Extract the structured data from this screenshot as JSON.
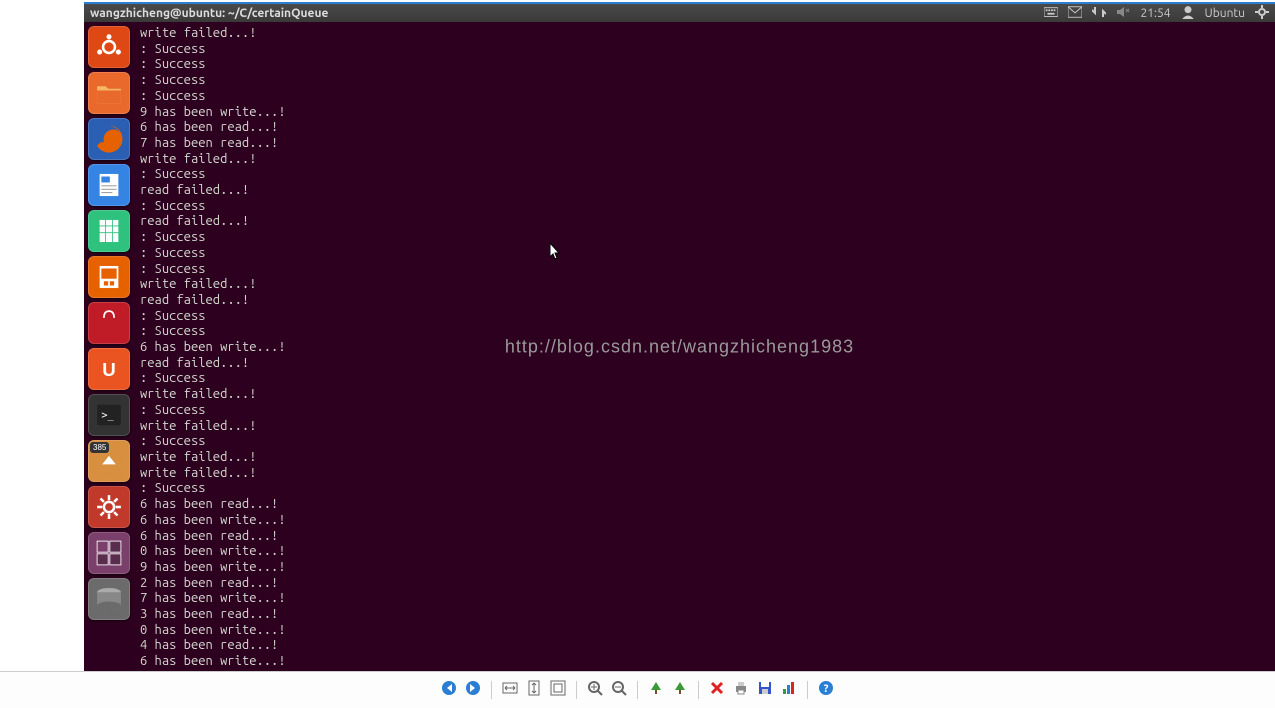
{
  "topbar": {
    "title": "wangzhicheng@ubuntu: ~/C/certainQueue",
    "time": "21:54",
    "user": "Ubuntu"
  },
  "watermark": "http://blog.csdn.net/wangzhicheng1983",
  "terminal_lines": [
    "write failed...!",
    ": Success",
    ": Success",
    ": Success",
    ": Success",
    "9 has been write...!",
    "6 has been read...!",
    "7 has been read...!",
    "write failed...!",
    ": Success",
    "read failed...!",
    ": Success",
    "read failed...!",
    ": Success",
    ": Success",
    ": Success",
    "write failed...!",
    "read failed...!",
    ": Success",
    ": Success",
    "6 has been write...!",
    "read failed...!",
    ": Success",
    "write failed...!",
    ": Success",
    "write failed...!",
    ": Success",
    "write failed...!",
    "write failed...!",
    ": Success",
    "6 has been read...!",
    "6 has been write...!",
    "6 has been read...!",
    "0 has been write...!",
    "9 has been write...!",
    "2 has been read...!",
    "7 has been write...!",
    "3 has been read...!",
    "0 has been write...!",
    "4 has been read...!",
    "6 has been write...!"
  ],
  "launcher": [
    {
      "name": "dash",
      "color": "#dd4814",
      "icon": "ubuntu"
    },
    {
      "name": "files",
      "color": "#e9692c",
      "icon": "folder"
    },
    {
      "name": "firefox",
      "color": "#2a5fb4",
      "icon": "firefox"
    },
    {
      "name": "writer",
      "color": "#3584e4",
      "icon": "writer"
    },
    {
      "name": "calc",
      "color": "#2ec27e",
      "icon": "calc"
    },
    {
      "name": "impress",
      "color": "#e66100",
      "icon": "impress"
    },
    {
      "name": "software",
      "color": "#c01c28",
      "icon": "bag"
    },
    {
      "name": "ubuntu-one",
      "color": "#e95420",
      "icon": "u1"
    },
    {
      "name": "terminal",
      "color": "#333333",
      "icon": "term"
    },
    {
      "name": "updates",
      "color": "#d88f3f",
      "icon": "up",
      "badge": "385"
    },
    {
      "name": "settings",
      "color": "#c0392b",
      "icon": "gear"
    },
    {
      "name": "workspace",
      "color": "#7b3f6b",
      "icon": "ws"
    },
    {
      "name": "disk",
      "color": "#6b6b6b",
      "icon": "disk"
    }
  ],
  "toolbar_icons": [
    {
      "name": "prev-button",
      "glyph": "prev",
      "color": "#2a7fd4"
    },
    {
      "name": "next-button",
      "glyph": "next",
      "color": "#2a7fd4"
    },
    {
      "name": "sep"
    },
    {
      "name": "fit-width-button",
      "glyph": "fitw",
      "color": "#666"
    },
    {
      "name": "fit-page-button",
      "glyph": "fitp",
      "color": "#666"
    },
    {
      "name": "fit-screen-button",
      "glyph": "fits",
      "color": "#666"
    },
    {
      "name": "sep"
    },
    {
      "name": "zoom-in-button",
      "glyph": "zin",
      "color": "#666"
    },
    {
      "name": "zoom-out-button",
      "glyph": "zout",
      "color": "#666"
    },
    {
      "name": "sep"
    },
    {
      "name": "tree-a-button",
      "glyph": "tree",
      "color": "#3a9a3a"
    },
    {
      "name": "tree-b-button",
      "glyph": "tree",
      "color": "#3a9a3a"
    },
    {
      "name": "sep"
    },
    {
      "name": "delete-button",
      "glyph": "del",
      "color": "#d22"
    },
    {
      "name": "print-button",
      "glyph": "print",
      "color": "#888"
    },
    {
      "name": "save-button",
      "glyph": "save",
      "color": "#3355cc"
    },
    {
      "name": "chart-button",
      "glyph": "chart",
      "color": "#3a9a3a"
    },
    {
      "name": "sep"
    },
    {
      "name": "help-button",
      "glyph": "help",
      "color": "#2a7fd4"
    }
  ]
}
